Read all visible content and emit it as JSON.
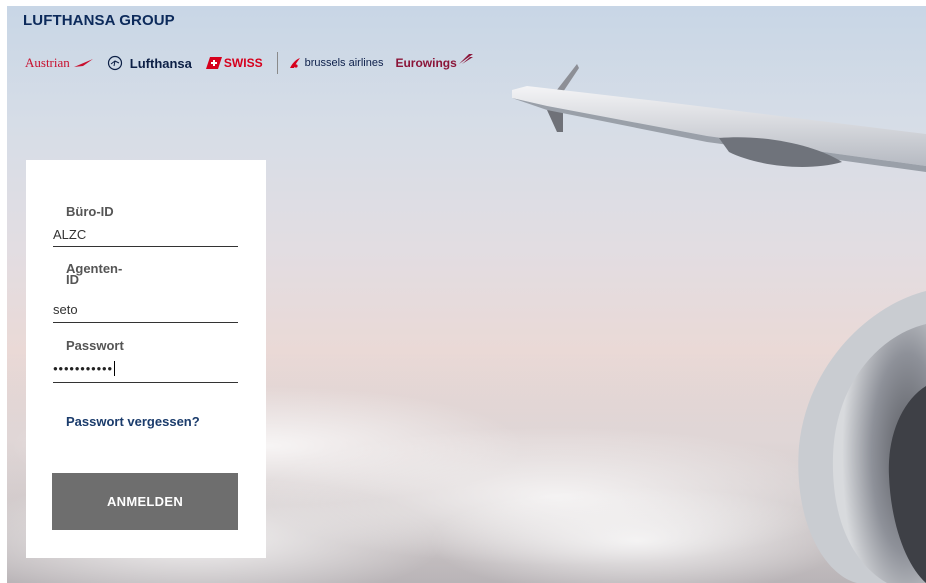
{
  "header": {
    "group_title": "LUFTHANSA GROUP",
    "airlines": [
      {
        "name": "Austrian",
        "icon": "austrian-chevron-icon"
      },
      {
        "name": "Lufthansa",
        "icon": "crane-icon"
      },
      {
        "name": "SWISS",
        "icon": "swiss-flag-icon"
      },
      {
        "name": "brussels airlines",
        "icon": "brussels-dots-icon"
      },
      {
        "name": "Eurowings",
        "icon": "eurowings-wing-icon"
      }
    ]
  },
  "login": {
    "office_id_label": "Büro-ID",
    "office_id_value": "ALZC",
    "agent_id_label": "Agenten-\nID",
    "agent_id_value": "seto",
    "password_label": "Passwort",
    "password_value": "●●●●●●●●●●●",
    "forgot_password": "Passwort vergessen?",
    "submit_label": "ANMELDEN"
  },
  "colors": {
    "brand_navy": "#0c2a5b",
    "austrian_red": "#c8102e",
    "swiss_red": "#d6001c",
    "eurowings_burgundy": "#8b1538",
    "button_gray": "#6e6e6e",
    "link_blue": "#1b3c6c"
  }
}
